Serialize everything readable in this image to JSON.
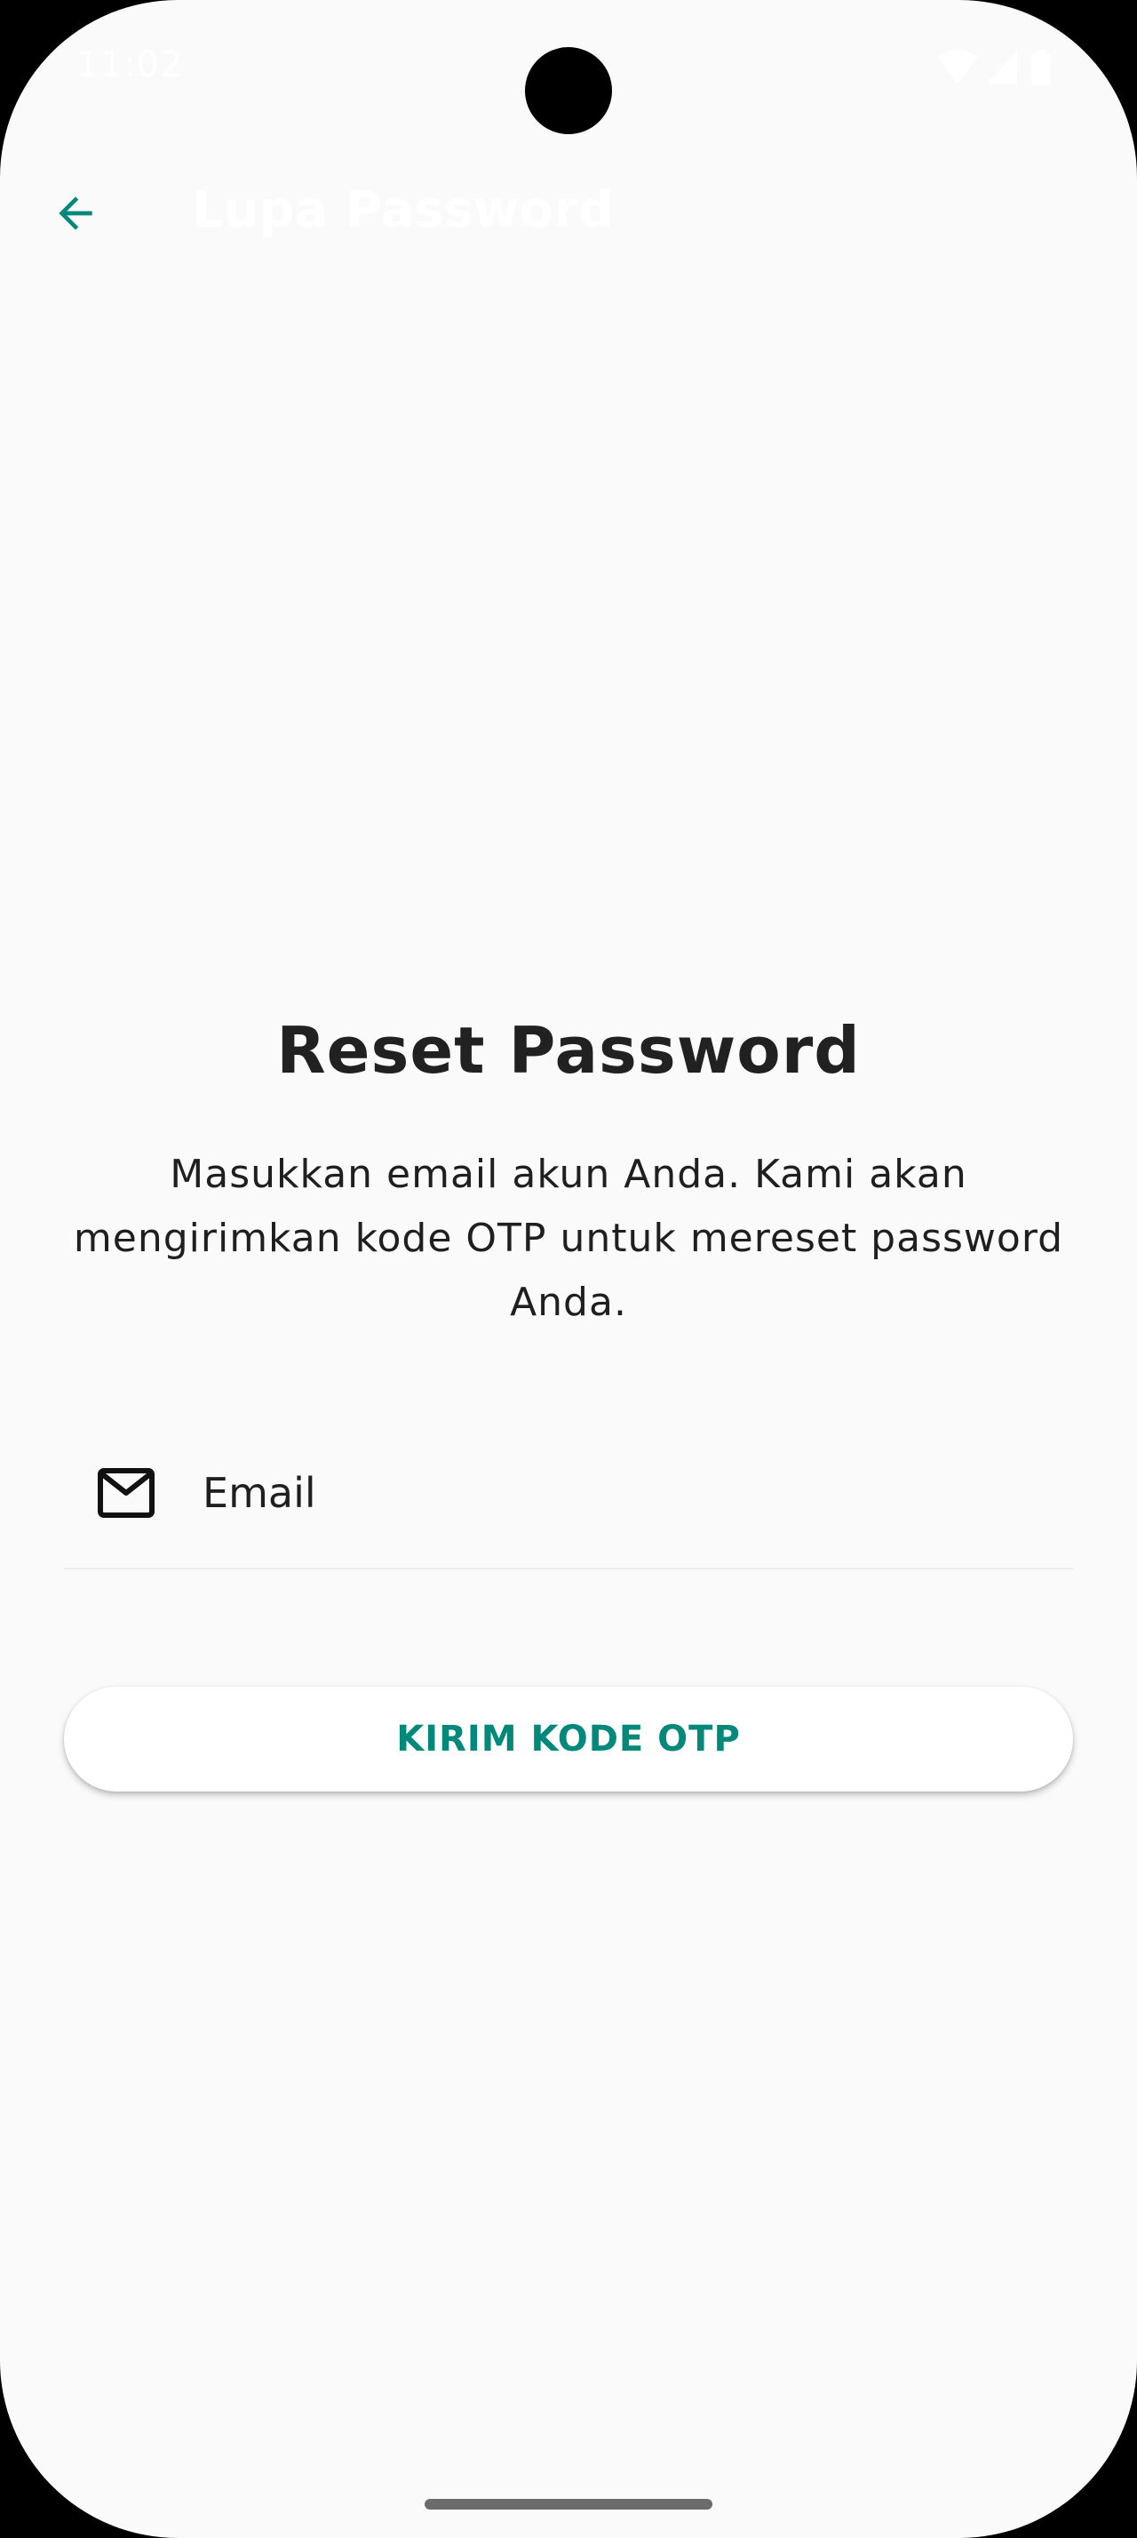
{
  "status_bar": {
    "time": "11:02",
    "icons": [
      "wifi-icon",
      "cellular-signal-icon",
      "battery-icon"
    ]
  },
  "app_bar": {
    "back_icon": "arrow-back-icon",
    "title": "Lupa Password"
  },
  "main": {
    "heading": "Reset Password",
    "description": "Masukkan email akun Anda. Kami akan mengirimkan kode OTP untuk mereset password Anda.",
    "email_field": {
      "icon": "mail-icon",
      "placeholder": "Email",
      "value": ""
    },
    "send_button_label": "KIRIM KODE OTP"
  },
  "colors": {
    "accent": "#00897b",
    "background": "#fafafa",
    "text": "#212121"
  }
}
